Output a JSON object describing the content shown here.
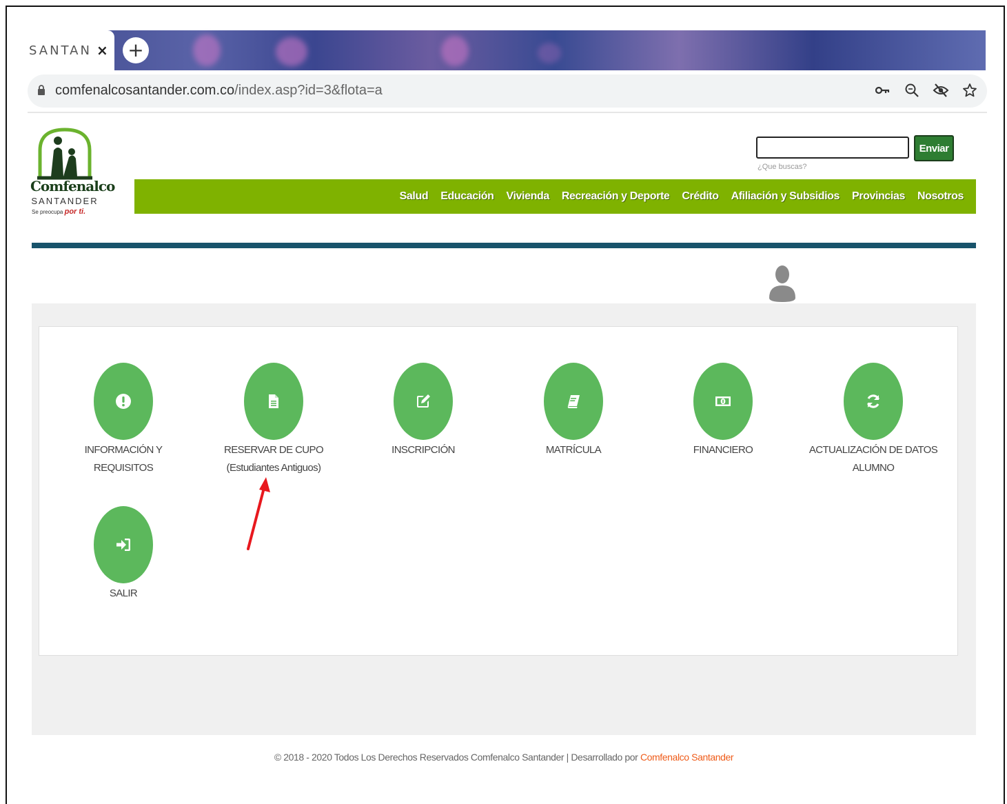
{
  "browser": {
    "tab_title": "SANTANDER",
    "tab_close": "×",
    "new_tab": "+",
    "url_host": "comfenalcosantander.com.co",
    "url_path": "/index.asp?id=3&flota=a"
  },
  "site": {
    "logo_name": "Comfenalco",
    "logo_sub": "SANTANDER",
    "logo_tag_prefix": "Se preocupa",
    "logo_tag_red": "por ti.",
    "search": {
      "value": "",
      "button_label": "Enviar",
      "hint": "¿Que buscas?"
    },
    "nav": [
      {
        "label": "Salud"
      },
      {
        "label": "Educación"
      },
      {
        "label": "Vivienda"
      },
      {
        "label": "Recreación y Deporte"
      },
      {
        "label": "Crédito"
      },
      {
        "label": "Afiliación y Subsidios"
      },
      {
        "label": "Provincias"
      },
      {
        "label": "Nosotros"
      }
    ]
  },
  "menu": [
    {
      "line1": "INFORMACIÓN Y",
      "line2": "REQUISITOS",
      "icon": "exclamation-icon"
    },
    {
      "line1": "RESERVAR DE CUPO",
      "line2": "(Estudiantes Antiguos)",
      "icon": "file-icon"
    },
    {
      "line1": "INSCRIPCIÓN",
      "line2": "",
      "icon": "edit-icon"
    },
    {
      "line1": "MATRÍCULA",
      "line2": "",
      "icon": "book-icon"
    },
    {
      "line1": "FINANCIERO",
      "line2": "",
      "icon": "money-icon"
    },
    {
      "line1": "ACTUALIZACIÓN DE DATOS",
      "line2": "ALUMNO",
      "icon": "refresh-icon"
    },
    {
      "line1": "SALIR",
      "line2": "",
      "icon": "sign-in-icon"
    }
  ],
  "footer": {
    "text": "© 2018 - 2020 Todos Los Derechos Reservados Comfenalco Santander | Desarrollado por ",
    "brand": "Comfenalco Santander"
  },
  "colors": {
    "nav_green": "#7fb200",
    "circle_green": "#5cb85c",
    "header_rule": "#18536b",
    "footer_brand": "#ef5c1a",
    "button_green": "#2e7d32"
  }
}
